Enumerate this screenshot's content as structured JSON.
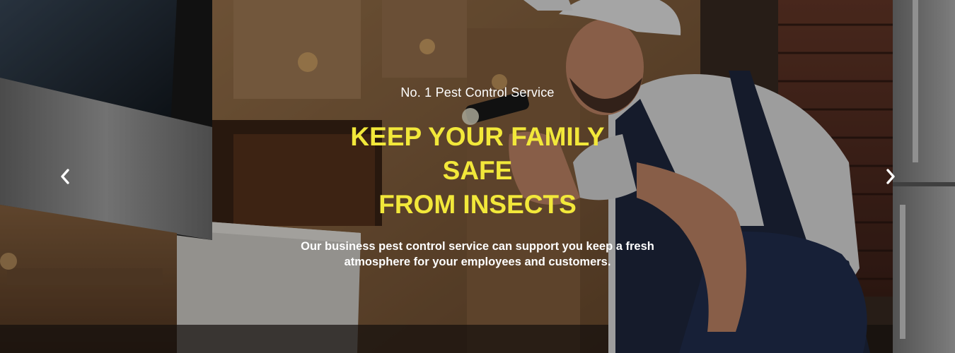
{
  "hero": {
    "eyebrow": "No. 1 Pest Control Service",
    "headline": [
      "KEEP YOUR FAMILY",
      "SAFE",
      "FROM INSECTS"
    ],
    "description": [
      "Our business pest control service can support you keep a fresh",
      "atmosphere for your employees and customers."
    ]
  },
  "controls": {
    "prev_icon": "chevron-left-icon",
    "next_icon": "chevron-right-icon"
  },
  "colors": {
    "headline": "#f2e83a",
    "text": "#ffffff",
    "overlay": "#000000"
  }
}
